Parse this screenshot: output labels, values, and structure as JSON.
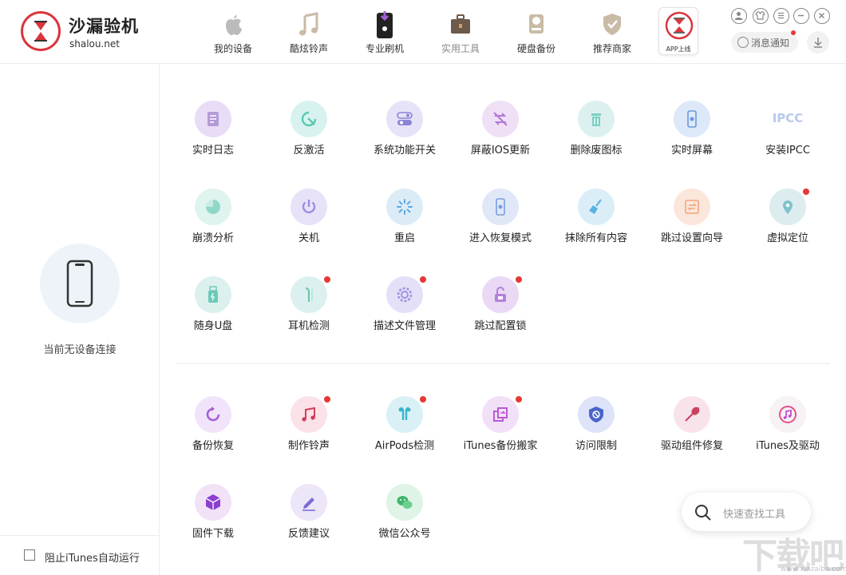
{
  "brand": {
    "name": "沙漏验机",
    "url": "shalou.net"
  },
  "nav": [
    {
      "label": "我的设备",
      "icon": "apple-icon"
    },
    {
      "label": "酷炫铃声",
      "icon": "music-note-icon"
    },
    {
      "label": "专业刷机",
      "icon": "flash-phone-icon"
    },
    {
      "label": "实用工具",
      "icon": "toolbox-icon"
    },
    {
      "label": "硬盘备份",
      "icon": "hard-drive-icon"
    },
    {
      "label": "推荐商家",
      "icon": "shield-check-icon"
    },
    {
      "label": "APP上线",
      "icon": "hourglass-icon"
    }
  ],
  "header_actions": {
    "notice_label": "消息通知"
  },
  "sidebar": {
    "status": "当前无设备连接",
    "itunes_checkbox_label": "阻止iTunes自动运行",
    "itunes_checked": false
  },
  "tools_top": [
    {
      "label": "实时日志",
      "icon": "log-icon",
      "color": "#e9dcf7"
    },
    {
      "label": "反激活",
      "icon": "deactivate-icon",
      "color": "#d8f3ef"
    },
    {
      "label": "系统功能开关",
      "icon": "toggle-icon",
      "color": "#e6e3f8"
    },
    {
      "label": "屏蔽IOS更新",
      "icon": "block-update-icon",
      "color": "#efe0f6"
    },
    {
      "label": "删除废图标",
      "icon": "delete-icon",
      "color": "#dcf1ef"
    },
    {
      "label": "实时屏幕",
      "icon": "screen-icon",
      "color": "#dde8f8"
    },
    {
      "label": "安装IPCC",
      "icon": "ipcc-icon",
      "color": "#ffffff",
      "text": "IPCC"
    },
    {
      "label": "崩溃分析",
      "icon": "pie-icon",
      "color": "#dff3ef"
    },
    {
      "label": "关机",
      "icon": "power-icon",
      "color": "#e7e2f8"
    },
    {
      "label": "重启",
      "icon": "restart-icon",
      "color": "#dcecf7"
    },
    {
      "label": "进入恢复模式",
      "icon": "recovery-icon",
      "color": "#e0e8f8"
    },
    {
      "label": "抹除所有内容",
      "icon": "broom-icon",
      "color": "#dbeef8"
    },
    {
      "label": "跳过设置向导",
      "icon": "skip-setup-icon",
      "color": "#fbe6dc"
    },
    {
      "label": "虚拟定位",
      "icon": "location-icon",
      "color": "#dcecef",
      "badge": true
    },
    {
      "label": "随身U盘",
      "icon": "usb-icon",
      "color": "#dcf0ee"
    },
    {
      "label": "耳机检测",
      "icon": "earphone-icon",
      "color": "#dcf1ef",
      "badge": true
    },
    {
      "label": "描述文件管理",
      "icon": "gear-icon",
      "color": "#e4e0f8",
      "badge": true
    },
    {
      "label": "跳过配置锁",
      "icon": "unlock-icon",
      "color": "#ead9f5",
      "badge": true
    }
  ],
  "tools_bottom": [
    {
      "label": "备份恢复",
      "icon": "backup-icon",
      "color": "#f1e4fa"
    },
    {
      "label": "制作铃声",
      "icon": "ringtone-icon",
      "color": "#fbe2e8",
      "badge": true
    },
    {
      "label": "AirPods检测",
      "icon": "airpods-icon",
      "color": "#d9f1f6",
      "badge": true
    },
    {
      "label": "iTunes备份搬家",
      "icon": "backup-move-icon",
      "color": "#f1e0f7",
      "badge": true
    },
    {
      "label": "访问限制",
      "icon": "restrict-icon",
      "color": "#dde3f8"
    },
    {
      "label": "驱动组件修复",
      "icon": "wrench-icon",
      "color": "#f9e3ea"
    },
    {
      "label": "iTunes及驱动",
      "icon": "itunes-icon",
      "color": "#f7f2f4"
    },
    {
      "label": "固件下载",
      "icon": "cube-icon",
      "color": "#f1e2f7"
    },
    {
      "label": "反馈建议",
      "icon": "pen-icon",
      "color": "#ede5f8"
    },
    {
      "label": "微信公众号",
      "icon": "wechat-icon",
      "color": "#dff3e6"
    }
  ],
  "search": {
    "placeholder": "快速查找工具"
  },
  "watermark": {
    "text": "下载吧",
    "url": "www.xiazaiba.com"
  }
}
